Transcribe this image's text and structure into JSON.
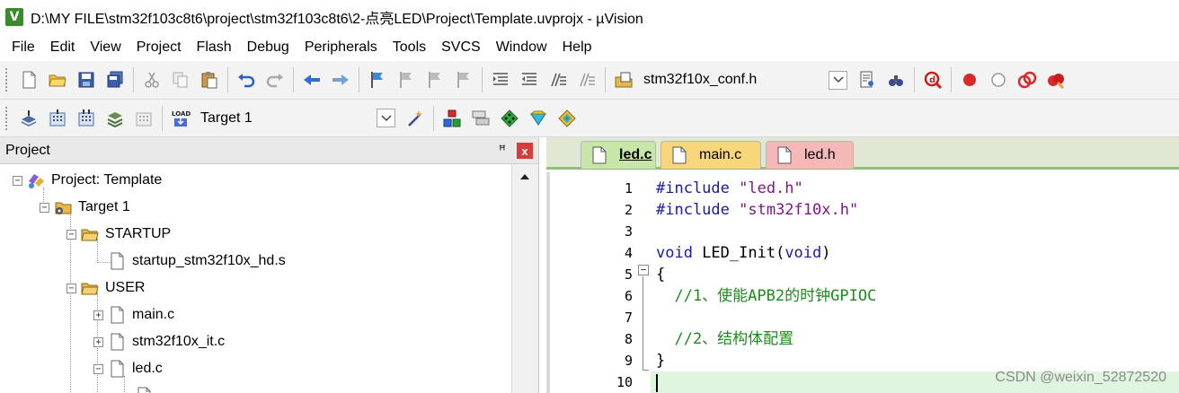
{
  "window": {
    "title": "D:\\MY FILE\\stm32f103c8t6\\project\\stm32f103c8t6\\2-点亮LED\\Project\\Template.uvprojx - µVision",
    "app_icon_letter": "V"
  },
  "menu": [
    "File",
    "Edit",
    "View",
    "Project",
    "Flash",
    "Debug",
    "Peripherals",
    "Tools",
    "SVCS",
    "Window",
    "Help"
  ],
  "toolbar1": {
    "file_combo_value": "stm32f10x_conf.h"
  },
  "toolbar2": {
    "load_label": "LOAD",
    "target_combo_value": "Target 1"
  },
  "project_pane": {
    "title": "Project",
    "pin": "ꟸ",
    "close": "x",
    "tree": [
      {
        "label": "Project: Template",
        "kind": "project",
        "level": 0,
        "expander": "−"
      },
      {
        "label": "Target 1",
        "kind": "target",
        "level": 1,
        "expander": "−"
      },
      {
        "label": "STARTUP",
        "kind": "folder",
        "level": 2,
        "expander": "−"
      },
      {
        "label": "startup_stm32f10x_hd.s",
        "kind": "file",
        "level": 3,
        "expander": ""
      },
      {
        "label": "USER",
        "kind": "folder",
        "level": 2,
        "expander": "−"
      },
      {
        "label": "main.c",
        "kind": "file",
        "level": 3,
        "expander": "+"
      },
      {
        "label": "stm32f10x_it.c",
        "kind": "file",
        "level": 3,
        "expander": "+"
      },
      {
        "label": "led.c",
        "kind": "file",
        "level": 3,
        "expander": "−"
      }
    ]
  },
  "editor": {
    "tabs": [
      {
        "label": "led.c",
        "active": true
      },
      {
        "label": "main.c",
        "active": false
      },
      {
        "label": "led.h",
        "active": false
      }
    ],
    "lines": [
      {
        "no": "1",
        "parts": [
          [
            "pp",
            "#include "
          ],
          [
            "str",
            "\"led.h\""
          ]
        ]
      },
      {
        "no": "2",
        "parts": [
          [
            "pp",
            "#include "
          ],
          [
            "str",
            "\"stm32f10x.h\""
          ]
        ]
      },
      {
        "no": "3",
        "parts": []
      },
      {
        "no": "4",
        "parts": [
          [
            "kw",
            "void"
          ],
          [
            "",
            " LED_Init("
          ],
          [
            "kw",
            "void"
          ],
          [
            "",
            ")"
          ]
        ]
      },
      {
        "no": "5",
        "parts": [
          [
            "",
            "{"
          ]
        ]
      },
      {
        "no": "6",
        "parts": [
          [
            "cm",
            "  //1、使能APB2的时钟GPIOC"
          ]
        ]
      },
      {
        "no": "7",
        "parts": []
      },
      {
        "no": "8",
        "parts": [
          [
            "cm",
            "  //2、结构体配置"
          ]
        ]
      },
      {
        "no": "9",
        "parts": [
          [
            "",
            "}"
          ]
        ]
      },
      {
        "no": "10",
        "parts": []
      }
    ]
  },
  "watermark": "CSDN @weixin_52872520"
}
